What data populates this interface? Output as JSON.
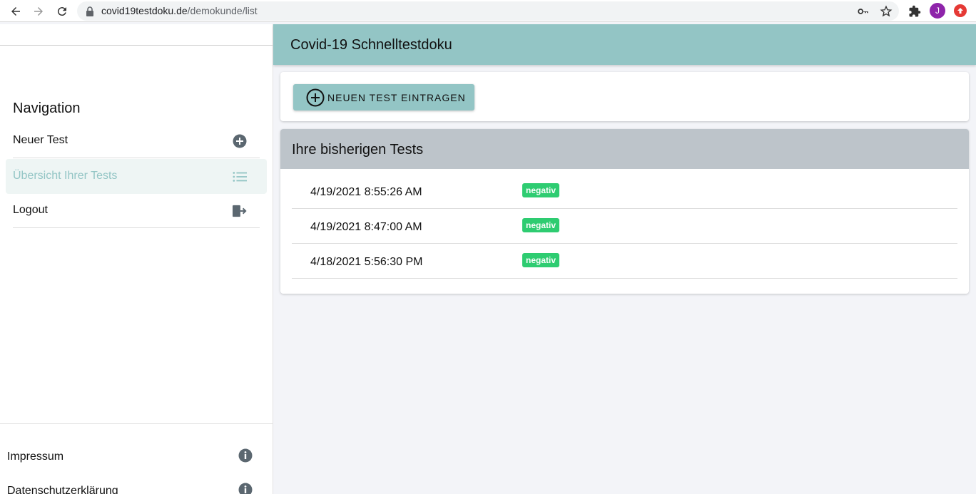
{
  "browser": {
    "url_host": "covid19testdoku.de",
    "url_path": "/demokunde/list",
    "avatar_letter": "J"
  },
  "sidebar": {
    "heading": "Navigation",
    "items": [
      {
        "label": "Neuer Test",
        "icon": "plus-circle-icon"
      },
      {
        "label": "Übersicht Ihrer Tests",
        "icon": "list-icon",
        "active": true
      },
      {
        "label": "Logout",
        "icon": "logout-icon"
      }
    ],
    "footer": [
      {
        "label": "Impressum",
        "icon": "info-icon"
      },
      {
        "label": "Datenschutzerklärung",
        "icon": "info-icon"
      }
    ]
  },
  "header": {
    "title": "Covid-19 Schnelltestdoku"
  },
  "actions": {
    "new_test_label": "NEUEN TEST EINTRAGEN"
  },
  "tests": {
    "title": "Ihre bisherigen Tests",
    "rows": [
      {
        "date": "4/19/2021 8:55:26 AM",
        "result": "negativ"
      },
      {
        "date": "4/19/2021 8:47:00 AM",
        "result": "negativ"
      },
      {
        "date": "4/18/2021 5:56:30 PM",
        "result": "negativ"
      }
    ]
  },
  "colors": {
    "accent": "#93c5c5",
    "badge_negative": "#2ecc71",
    "card_header": "#bdc4ca",
    "icon_gray": "#5b6770"
  }
}
